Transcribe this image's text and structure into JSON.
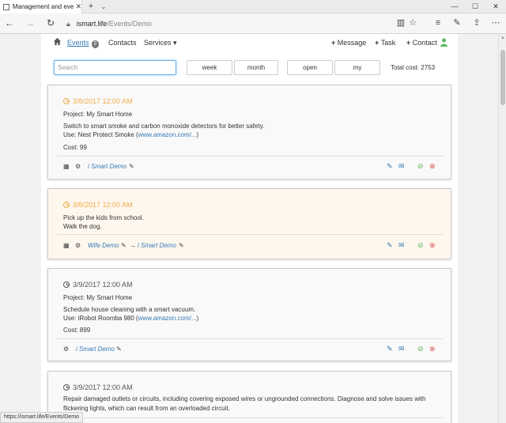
{
  "browser": {
    "tab_title": "Management and event",
    "url_host": "ismart.life",
    "url_path": "/Events/Demo",
    "status_url": "https://ismart.life/Events/Demo"
  },
  "nav": {
    "events_label": "Events",
    "events_count": "2",
    "contacts_label": "Contacts",
    "services_label": "Services ▾",
    "message_label": "Message",
    "task_label": "Task",
    "contact_label": "Contact"
  },
  "toolbar": {
    "search_placeholder": "Search",
    "week_label": "week",
    "month_label": "month",
    "open_label": "open",
    "my_label": "my",
    "total_cost_label": "Total cost:",
    "total_cost_value": "2753"
  },
  "events": [
    {
      "datetime": "3/8/2017 12:00 AM",
      "project": "Project: My Smart Home",
      "description": "Switch to smart smoke and carbon monoxide detectors for better safety.",
      "use_prefix": "Use: Nest Protect Smoke (",
      "use_link": "www.amazon.com/...",
      "use_suffix": ")",
      "cost": "Cost: 99",
      "assignee": "i Smart Demo"
    },
    {
      "datetime": "3/8/2017 12:00 AM",
      "line1": "Pick up the kids from school.",
      "line2": "Walk the dog.",
      "from": "Wife Demo",
      "to": "i Smart Demo"
    },
    {
      "datetime": "3/9/2017 12:00 AM",
      "project": "Project: My Smart Home",
      "description": "Schedule house cleaning with a smart vacuum.",
      "use_prefix": "Use: iRobot Roomba 980 (",
      "use_link": "www.amazon.com/...",
      "use_suffix": ")",
      "cost": "Cost: 899",
      "assignee": "i Smart Demo"
    },
    {
      "datetime": "3/9/2017 12:00 AM",
      "description": "Repair damaged outlets or circuits, including covering exposed wires or ungrounded connections. Diagnose and solve issues with flickering lights, which can result from an overloaded circuit."
    }
  ],
  "colors": {
    "accent": "#337ab7",
    "pending_date": "#f0ad4e",
    "highlight_bg": "#fef7ed",
    "ok": "#5cb85c",
    "cancel": "#d9534f"
  }
}
